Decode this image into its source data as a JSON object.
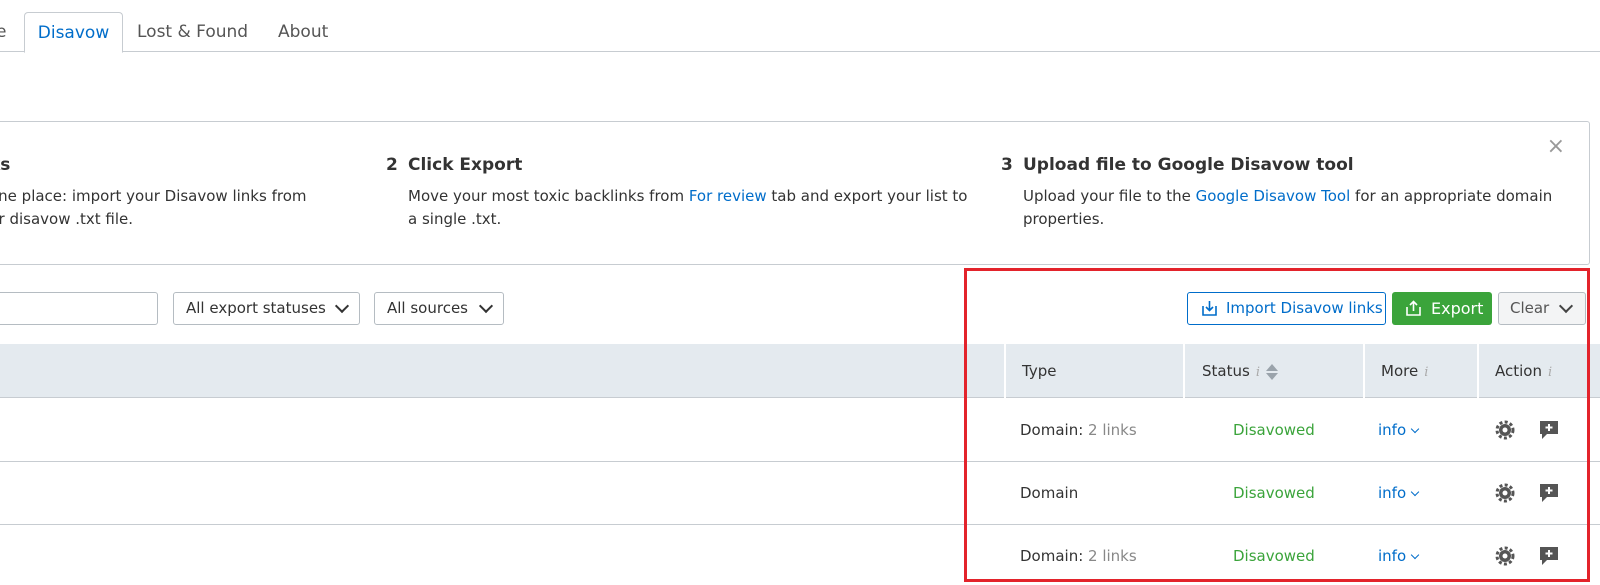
{
  "tabs": {
    "partial": "e",
    "active": "Disavow",
    "lost_found": "Lost & Found",
    "about": "About"
  },
  "steps": [
    {
      "num": "",
      "title": "ks",
      "text1": "one place: import your Disavow links from",
      "text2": "ur disavow .txt file."
    },
    {
      "num": "2",
      "title": "Click Export",
      "text1_pre": "Move your most toxic backlinks from ",
      "text1_link": "For review",
      "text1_post": " tab and export your list to",
      "text2": "a single .txt."
    },
    {
      "num": "3",
      "title": "Upload file to Google Disavow tool",
      "text1_pre": "Upload your file to the ",
      "text1_link": "Google Disavow Tool",
      "text1_post": " for an appropriate domain",
      "text2": "properties."
    }
  ],
  "close_glyph": "×",
  "filters": {
    "export_status": "All export statuses",
    "sources": "All sources"
  },
  "toolbar": {
    "import_label": "Import Disavow links",
    "export_label": "Export",
    "clear_label": "Clear"
  },
  "table": {
    "headers": {
      "type": "Type",
      "status": "Status",
      "more": "More",
      "action": "Action"
    },
    "info_glyph": "i",
    "rows": [
      {
        "type": "Domain:",
        "count": " 2 links",
        "status": "Disavowed",
        "more": "info"
      },
      {
        "type": "Domain",
        "count": "",
        "status": "Disavowed",
        "more": "info"
      },
      {
        "type": "Domain:",
        "count": " 2 links",
        "status": "Disavowed",
        "more": "info"
      }
    ]
  },
  "colors": {
    "accent": "#006dca",
    "success": "#3ba43b",
    "highlight": "#e3232b",
    "header_bg": "#e4eaef"
  },
  "icons": {
    "import": "download-icon",
    "export": "upload-icon",
    "gear": "gear-icon",
    "comment": "comment-add-icon",
    "close": "close-icon"
  }
}
